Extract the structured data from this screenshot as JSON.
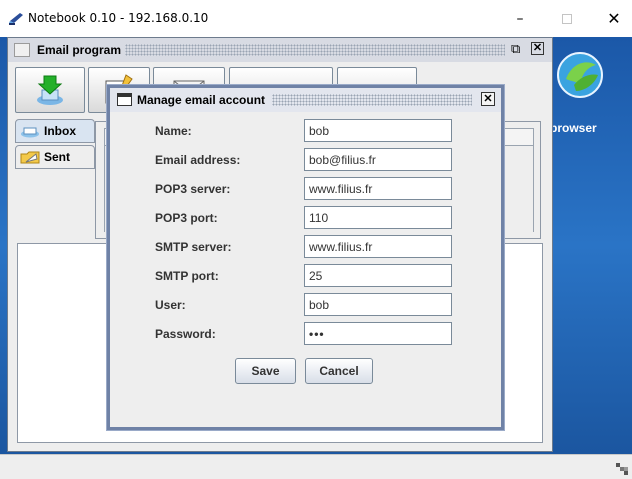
{
  "window": {
    "title": "Notebook 0.10 - 192.168.0.10",
    "minimize_glyph": "–",
    "close_glyph": "✕"
  },
  "desktop": {
    "icon_label": "browser"
  },
  "email_program": {
    "title": "Email program",
    "undock_glyph": "⧉",
    "close_glyph": "✕",
    "tabs": [
      {
        "label": "Inbox",
        "selected": true
      },
      {
        "label": "Sent",
        "selected": false
      }
    ]
  },
  "dialog": {
    "title": "Manage email account",
    "close_glyph": "✕",
    "fields": [
      {
        "label": "Name:",
        "value": "bob"
      },
      {
        "label": "Email address:",
        "value": "bob@filius.fr"
      },
      {
        "label": "POP3 server:",
        "value": "www.filius.fr"
      },
      {
        "label": "POP3 port:",
        "value": "110"
      },
      {
        "label": "SMTP server:",
        "value": "www.filius.fr"
      },
      {
        "label": "SMTP port:",
        "value": "25"
      },
      {
        "label": "User:",
        "value": "bob"
      },
      {
        "label": "Password:",
        "value": "•••"
      }
    ],
    "save_label": "Save",
    "cancel_label": "Cancel"
  },
  "colors": {
    "desktop_blue": "#1f5da6",
    "frame_border": "#6f82a6",
    "tab_selected": "#d9e4f1"
  },
  "icons": {
    "app": "filius-notebook-icon",
    "receive": "receive-mail-icon",
    "compose": "compose-mail-icon",
    "reply": "envelope-icon",
    "inbox_tab": "inbox-tray-icon",
    "sent_tab": "sent-folder-icon",
    "desktop_browser": "browser-app-icon"
  }
}
